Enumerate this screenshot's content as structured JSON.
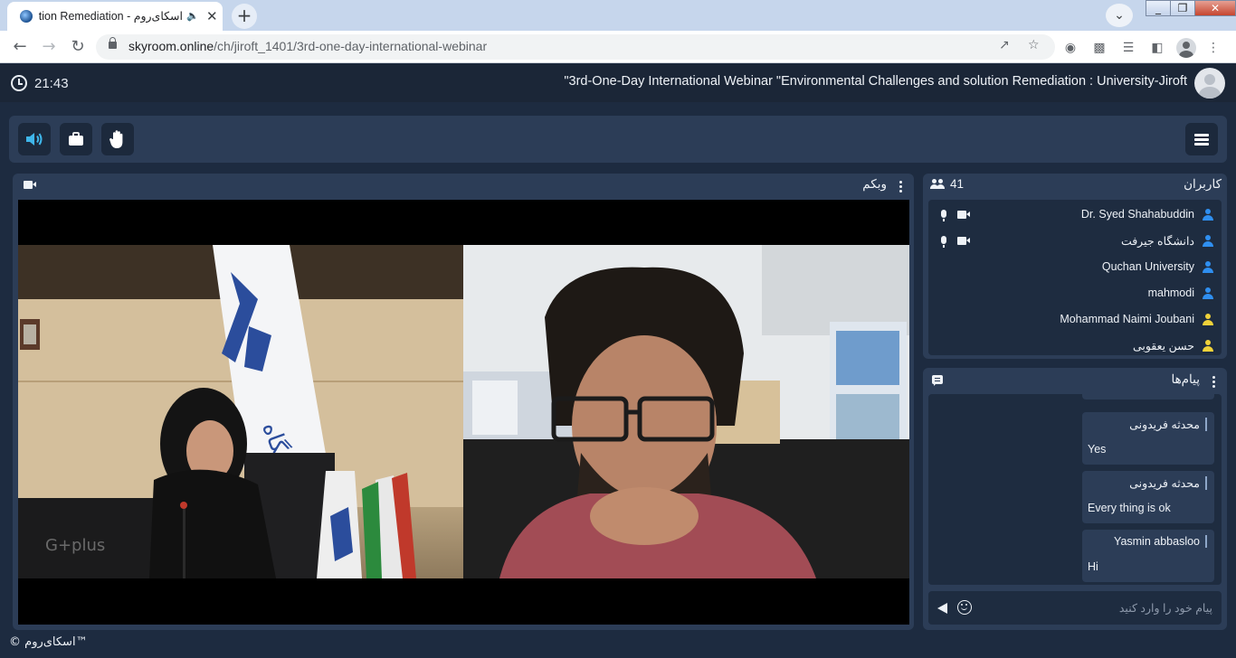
{
  "browser": {
    "tab_title": "اسکای‌روم - Environmental Challenges and solution Remediation",
    "tab_audio_icon": "speaker-icon",
    "new_tab_label": "+",
    "url_host": "skyroom.online",
    "url_path": "/ch/jiroft_1401/3rd-one-day-international-webinar",
    "window_buttons": [
      "_",
      "❐",
      "✕"
    ]
  },
  "header": {
    "time": "21:43",
    "title": "\"3rd-One-Day International Webinar \"Environmental Challenges and solution Remediation : University-Jiroft"
  },
  "toolbar": {
    "buttons": [
      "speaker-icon",
      "briefcase-icon",
      "raise-hand-icon"
    ],
    "menu_icon": "hamburger-menu-icon"
  },
  "webcam": {
    "title": "وبکم"
  },
  "users": {
    "title": "کاربران",
    "count": "41",
    "items": [
      {
        "name": "Dr. Syed Shahabuddin",
        "color": "#2f8ff0",
        "mic": true,
        "cam": true
      },
      {
        "name": "دانشگاه جیرفت",
        "color": "#2f8ff0",
        "mic": true,
        "cam": true
      },
      {
        "name": "Quchan University",
        "color": "#2f8ff0",
        "mic": false,
        "cam": false
      },
      {
        "name": "mahmodi",
        "color": "#2f8ff0",
        "mic": false,
        "cam": false
      },
      {
        "name": "Mohammad Naimi Joubani",
        "color": "#f0d23a",
        "mic": false,
        "cam": false
      },
      {
        "name": "حسن یعقوبی",
        "color": "#f0d23a",
        "mic": false,
        "cam": false
      }
    ]
  },
  "messages": {
    "title": "پیام‌ها",
    "items": [
      {
        "sender": "محدثه فریدونی",
        "text": "Yes"
      },
      {
        "sender": "محدثه فریدونی",
        "text": "Every thing is ok"
      },
      {
        "sender": "Yasmin abbasloo",
        "text": "Hi"
      }
    ],
    "input_placeholder": "پیام خود را وارد کنید"
  },
  "footer": {
    "brand": "© اسکای‌روم™"
  },
  "colors": {
    "accent": "#3fb6ea",
    "panel": "#2c3d57",
    "background": "#1d2b40"
  }
}
